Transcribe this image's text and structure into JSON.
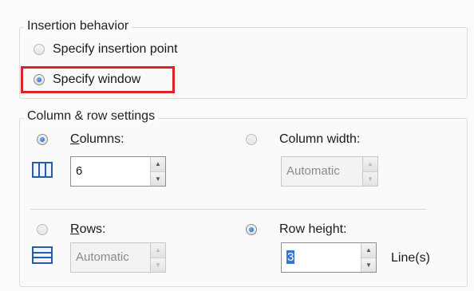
{
  "insertion": {
    "title": "Insertion behavior",
    "option_point": "Specify insertion point",
    "option_window": "Specify window"
  },
  "settings": {
    "title": "Column & row settings",
    "columns_label": "Columns:",
    "columns_value": "6",
    "column_width_label": "Column width:",
    "column_width_value": "Automatic",
    "rows_label": "Rows:",
    "rows_value": "Automatic",
    "row_height_label": "Row height:",
    "row_height_value": "3",
    "row_height_units": "Line(s)"
  },
  "icons": {
    "columns": "columns-grid-icon",
    "rows": "rows-grid-icon"
  },
  "colors": {
    "highlight": "#d8262a",
    "radio_dot": "#1f5db8",
    "selection": "#3b73d4"
  }
}
